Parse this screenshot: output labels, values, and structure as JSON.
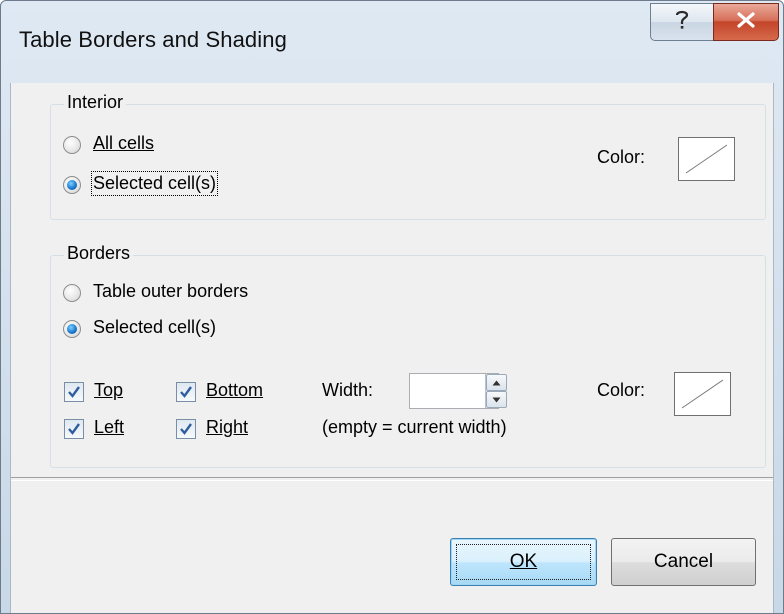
{
  "window": {
    "title": "Table Borders and Shading",
    "help_icon": "question-mark",
    "close_icon": "x"
  },
  "interior": {
    "group_label": "Interior",
    "option_all_cells": "All cells",
    "option_selected_cells": "Selected cell(s)",
    "selected_option": "Selected cell(s)",
    "color_label": "Color:"
  },
  "borders": {
    "group_label": "Borders",
    "option_table_outer": "Table outer borders",
    "option_selected_cells": "Selected cell(s)",
    "selected_option": "Selected cell(s)",
    "top_label": "Top",
    "top_checked": true,
    "bottom_label": "Bottom",
    "bottom_checked": true,
    "left_label": "Left",
    "left_checked": true,
    "right_label": "Right",
    "right_checked": true,
    "width_label": "Width:",
    "width_value": "",
    "width_hint": "(empty = current width)",
    "color_label": "Color:"
  },
  "buttons": {
    "ok": "OK",
    "cancel": "Cancel"
  }
}
